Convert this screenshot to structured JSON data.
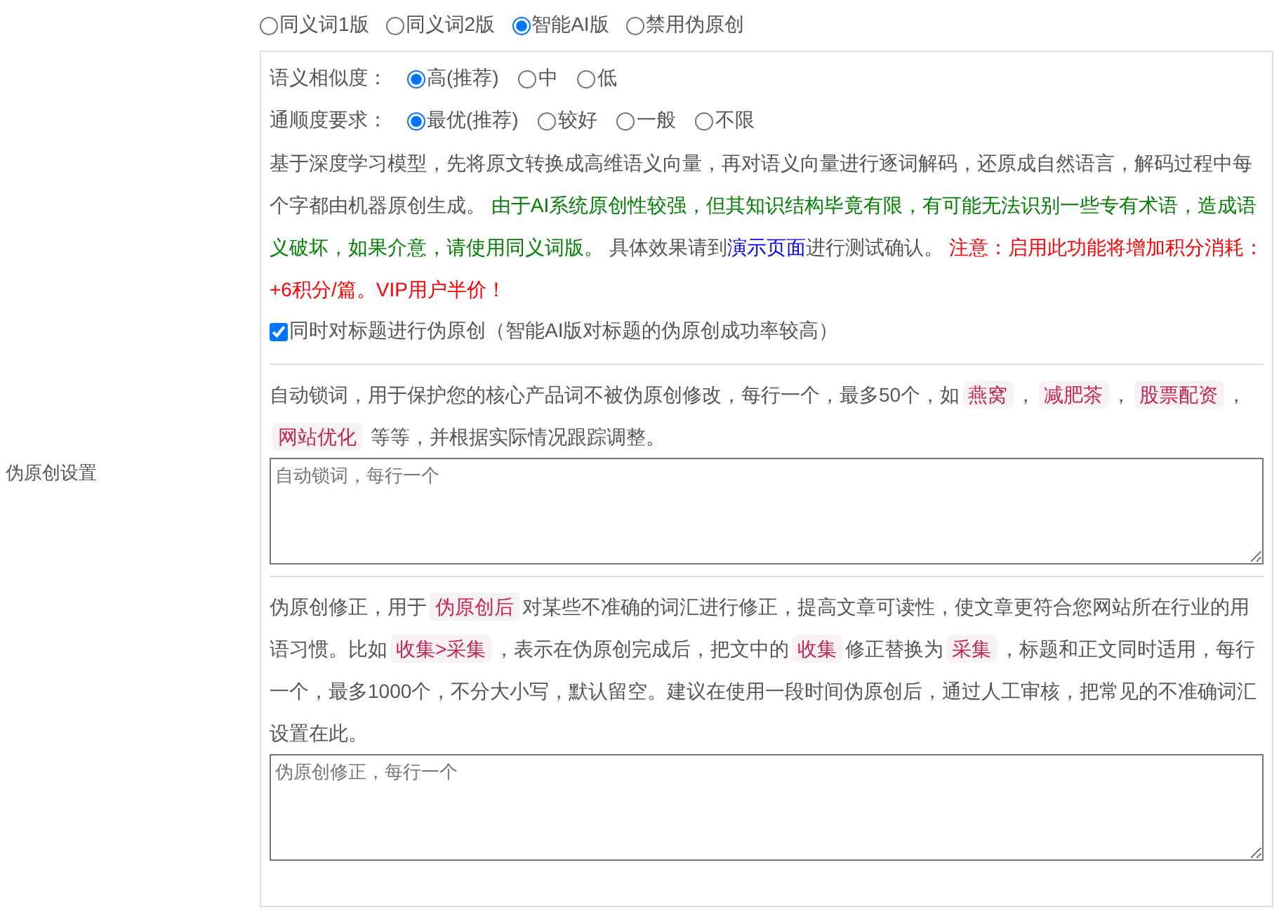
{
  "settings_label": "伪原创设置",
  "modes": [
    {
      "label": "同义词1版",
      "selected": false
    },
    {
      "label": "同义词2版",
      "selected": false
    },
    {
      "label": "智能AI版",
      "selected": true
    },
    {
      "label": "禁用伪原创",
      "selected": false
    }
  ],
  "ai_panel": {
    "similarity": {
      "label": "语义相似度：",
      "options": [
        {
          "label": "高(推荐)",
          "selected": true
        },
        {
          "label": "中",
          "selected": false
        },
        {
          "label": "低",
          "selected": false
        }
      ]
    },
    "fluency": {
      "label": "通顺度要求：",
      "options": [
        {
          "label": "最优(推荐)",
          "selected": true
        },
        {
          "label": "较好",
          "selected": false
        },
        {
          "label": "一般",
          "selected": false
        },
        {
          "label": "不限",
          "selected": false
        }
      ]
    },
    "description": [
      {
        "kind": "plain",
        "text": "基于深度学习模型，先将原文转换成高维语义向量，再对语义向量进行逐词解码，还原成自然语言，解码过程中每个字都由机器原创生成。 "
      },
      {
        "kind": "note",
        "text": "由于AI系统原创性较强，但其知识结构毕竟有限，有可能无法识别一些专有术语，造成语义破坏，如果介意，请使用同义词版。"
      },
      {
        "kind": "plain",
        "text": " 具体效果请到"
      },
      {
        "kind": "link",
        "text": "演示页面"
      },
      {
        "kind": "plain",
        "text": "进行测试确认。 "
      },
      {
        "kind": "warning",
        "text": "注意：启用此功能将增加积分消耗：+6积分/篇。VIP用户半价！"
      }
    ],
    "title_option": {
      "label": "同时对标题进行伪原创（智能AI版对标题的伪原创成功率较高）",
      "checked": true
    }
  },
  "lock_words": {
    "description": [
      {
        "kind": "plain",
        "text": "自动锁词，用于保护您的核心产品词不被伪原创修改，每行一个，最多50个，如"
      },
      {
        "kind": "code",
        "text": "燕窝"
      },
      {
        "kind": "plain",
        "text": "，"
      },
      {
        "kind": "code",
        "text": "减肥茶"
      },
      {
        "kind": "plain",
        "text": "，"
      },
      {
        "kind": "code",
        "text": "股票配资"
      },
      {
        "kind": "plain",
        "text": "，"
      },
      {
        "kind": "code",
        "text": "网站优化"
      },
      {
        "kind": "plain",
        "text": " 等等，并根据实际情况跟踪调整。"
      }
    ],
    "placeholder": "自动锁词，每行一个"
  },
  "correction": {
    "description": [
      {
        "kind": "plain",
        "text": "伪原创修正，用于"
      },
      {
        "kind": "code",
        "text": "伪原创后"
      },
      {
        "kind": "plain",
        "text": "对某些不准确的词汇进行修正，提高文章可读性，使文章更符合您网站所在行业的用语习惯。比如"
      },
      {
        "kind": "code",
        "text": "收集>采集"
      },
      {
        "kind": "plain",
        "text": "，表示在伪原创完成后，把文中的"
      },
      {
        "kind": "code",
        "text": "收集"
      },
      {
        "kind": "plain",
        "text": "修正替换为"
      },
      {
        "kind": "code",
        "text": "采集"
      },
      {
        "kind": "plain",
        "text": "，标题和正文同时适用，每行一个，最多1000个，不分大小写，默认留空。建议在使用一段时间伪原创后，通过人工审核，把常见的不准确词汇设置在此。"
      }
    ],
    "placeholder": "伪原创修正，每行一个"
  }
}
